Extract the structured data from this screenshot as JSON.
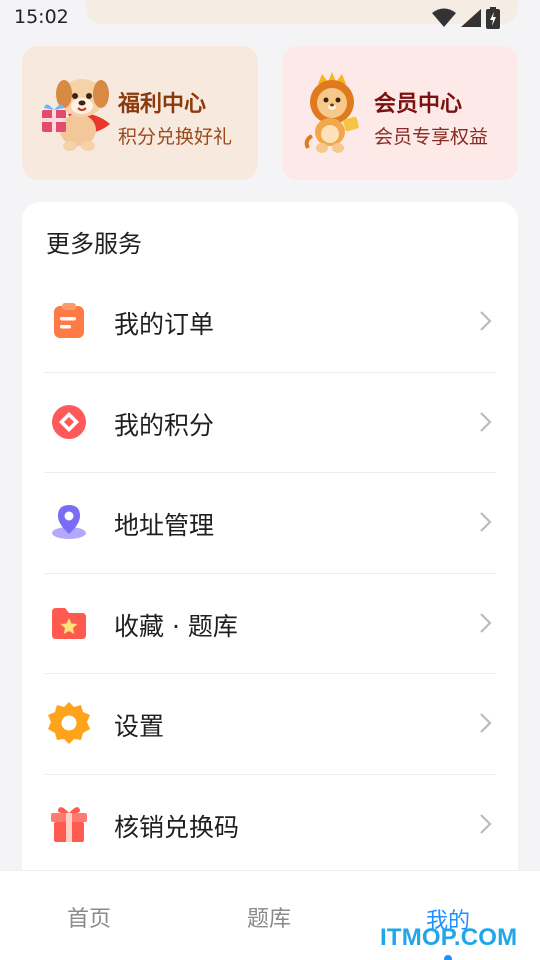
{
  "status_bar": {
    "time": "15:02",
    "icons": [
      "wifi-icon",
      "signal-icon",
      "battery-icon"
    ]
  },
  "promo_cards": [
    {
      "title": "福利中心",
      "subtitle": "积分兑换好礼",
      "icon": "dog-mascot-icon"
    },
    {
      "title": "会员中心",
      "subtitle": "会员专享权益",
      "icon": "lion-mascot-icon"
    }
  ],
  "services": {
    "title": "更多服务",
    "items": [
      {
        "label": "我的订单",
        "icon": "order-clipboard-icon",
        "color": "#ff7a45"
      },
      {
        "label": "我的积分",
        "icon": "points-diamond-icon",
        "color": "#ff5a5a"
      },
      {
        "label": "地址管理",
        "icon": "location-pin-icon",
        "color": "#7b6cf6"
      },
      {
        "label": "收藏 · 题库",
        "icon": "favorite-folder-icon",
        "color": "#ff5a50"
      },
      {
        "label": "设置",
        "icon": "gear-icon",
        "color": "#ffa31a"
      },
      {
        "label": "核销兑换码",
        "icon": "gift-icon",
        "color": "#ff5a50"
      }
    ]
  },
  "bottom_nav": {
    "items": [
      {
        "label": "首页",
        "active": false
      },
      {
        "label": "题库",
        "active": false
      },
      {
        "label": "我的",
        "active": true
      }
    ],
    "active_color": "#1e90ff"
  },
  "watermark": "ITMOP.COM"
}
